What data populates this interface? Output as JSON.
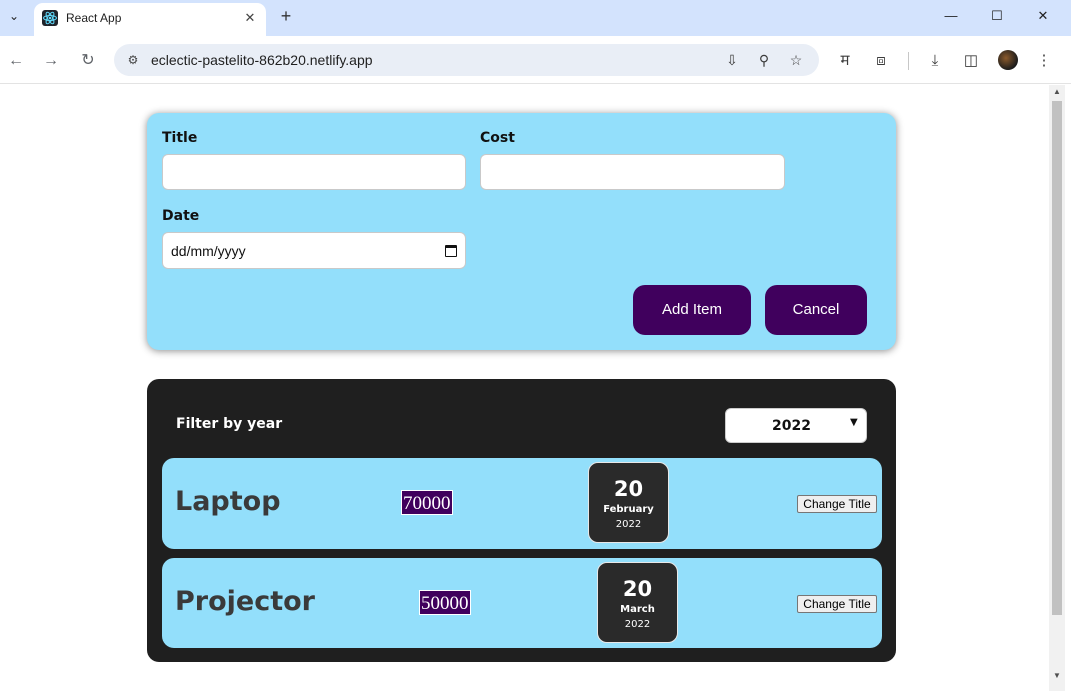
{
  "browser": {
    "tab_title": "React App",
    "url": "eclectic-pastelito-862b20.netlify.app"
  },
  "form": {
    "title_label": "Title",
    "title_value": "",
    "cost_label": "Cost",
    "cost_value": "",
    "date_label": "Date",
    "date_placeholder": "dd/mm/yyyy",
    "add_button": "Add Item",
    "cancel_button": "Cancel"
  },
  "expenses": {
    "filter_label": "Filter by year",
    "filter_value": "2022",
    "change_title_label": "Change Title",
    "items": [
      {
        "title": "Laptop",
        "amount": "70000",
        "day": "20",
        "month": "February",
        "year": "2022"
      },
      {
        "title": "Projector",
        "amount": "50000",
        "day": "20",
        "month": "March",
        "year": "2022"
      }
    ]
  },
  "icons": {
    "tab_search": "chevron-down-icon",
    "favicon": "react-logo-icon",
    "back": "back-arrow-icon",
    "forward": "forward-arrow-icon",
    "reload": "reload-icon",
    "install": "install-app-icon",
    "zoom": "zoom-icon",
    "bookmark": "star-icon",
    "translate": "translate-icon",
    "extensions": "puzzle-icon",
    "downloads": "download-icon",
    "side_panel": "side-panel-icon",
    "menu": "kebab-menu-icon"
  },
  "colors": {
    "form_bg": "#93dffb",
    "accent_button": "#40005d",
    "list_bg": "#1f1f1f"
  }
}
